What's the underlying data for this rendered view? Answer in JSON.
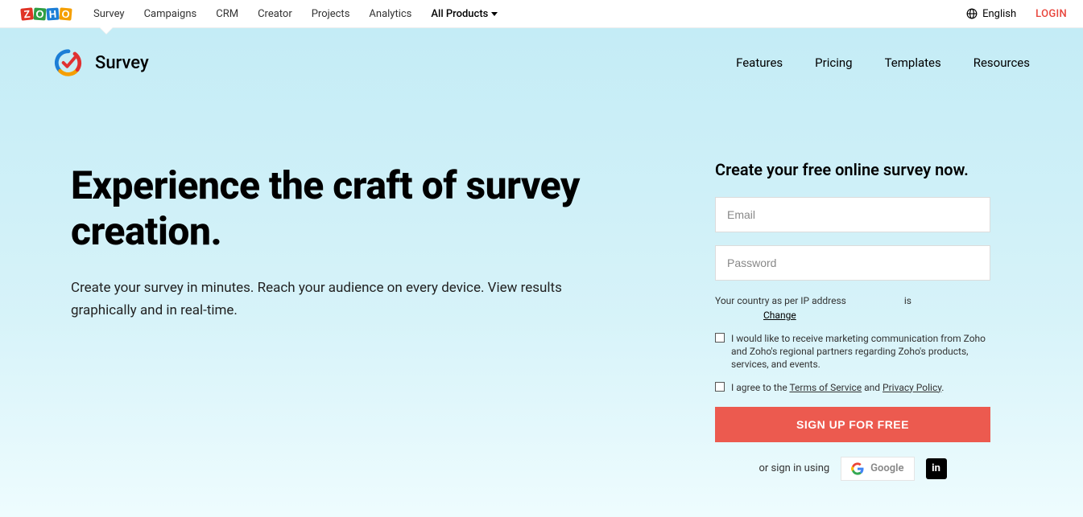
{
  "topbar": {
    "logo_letters": [
      "Z",
      "O",
      "H",
      "O"
    ],
    "nav": [
      "Survey",
      "Campaigns",
      "CRM",
      "Creator",
      "Projects",
      "Analytics"
    ],
    "all_products": "All Products",
    "language": "English",
    "login": "LOGIN"
  },
  "app": {
    "name": "Survey",
    "nav": [
      "Features",
      "Pricing",
      "Templates",
      "Resources"
    ]
  },
  "hero": {
    "headline": "Experience the craft of survey creation.",
    "subhead": "Create your survey in minutes. Reach your audience on every device. View results graphically and in real-time."
  },
  "signup": {
    "title": "Create your free online survey now.",
    "email_placeholder": "Email",
    "password_placeholder": "Password",
    "country_prefix": "Your country as per IP address",
    "country_suffix": "is",
    "change": "Change",
    "marketing_consent": "I would like to receive marketing communication from Zoho and Zoho's regional partners regarding Zoho's products, services, and events.",
    "agree_prefix": "I agree to the ",
    "tos": "Terms of Service",
    "agree_mid": " and ",
    "privacy": "Privacy Policy",
    "agree_suffix": ".",
    "button": "SIGN UP FOR FREE",
    "alt_label": "or sign in using",
    "google": "Google",
    "linkedin": "in"
  }
}
